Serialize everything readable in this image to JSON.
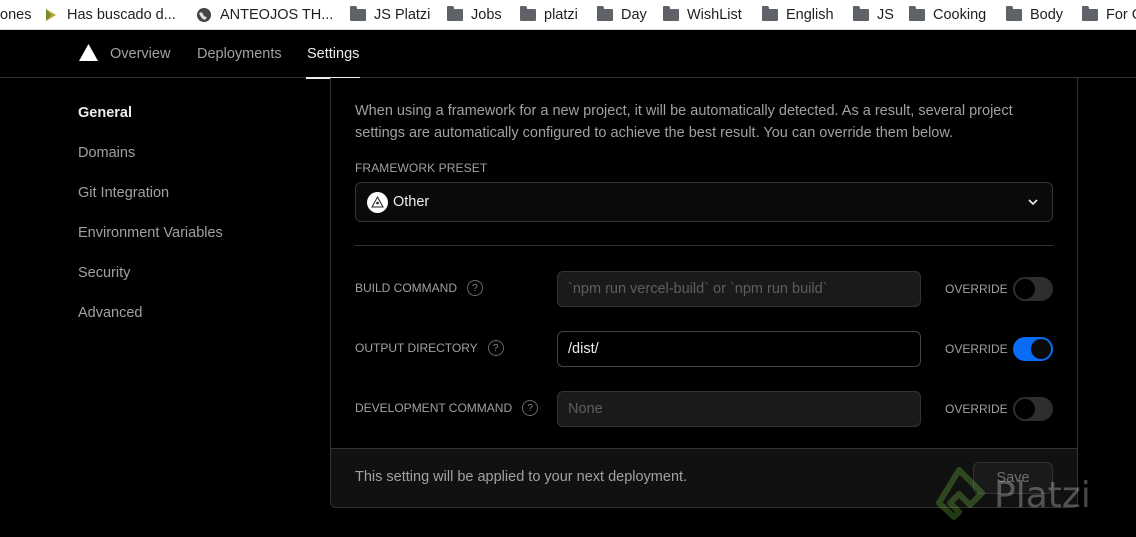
{
  "bookmarks": [
    {
      "label": "ones",
      "icon": "none"
    },
    {
      "label": "Has buscado d...",
      "icon": "arrow-icon"
    },
    {
      "label": "ANTEOJOS TH...",
      "icon": "globe-icon"
    },
    {
      "label": "JS Platzi",
      "icon": "folder-icon"
    },
    {
      "label": "Jobs",
      "icon": "folder-icon"
    },
    {
      "label": "platzi",
      "icon": "folder-icon"
    },
    {
      "label": "Day",
      "icon": "folder-icon"
    },
    {
      "label": "WishList",
      "icon": "folder-icon"
    },
    {
      "label": "English",
      "icon": "folder-icon"
    },
    {
      "label": "JS",
      "icon": "folder-icon"
    },
    {
      "label": "Cooking",
      "icon": "folder-icon"
    },
    {
      "label": "Body",
      "icon": "folder-icon"
    },
    {
      "label": "For G",
      "icon": "folder-icon"
    }
  ],
  "nav": {
    "tabs": [
      {
        "label": "Overview"
      },
      {
        "label": "Deployments"
      },
      {
        "label": "Settings",
        "active": true
      }
    ]
  },
  "sidebar": {
    "items": [
      {
        "label": "General",
        "active": true
      },
      {
        "label": "Domains"
      },
      {
        "label": "Git Integration"
      },
      {
        "label": "Environment Variables"
      },
      {
        "label": "Security"
      },
      {
        "label": "Advanced"
      }
    ]
  },
  "card": {
    "description": "When using a framework for a new project, it will be automatically detected. As a result, several project settings are automatically configured to achieve the best result. You can override them below.",
    "framework_preset": {
      "label": "FRAMEWORK PRESET",
      "value": "Other"
    },
    "rows": [
      {
        "label": "BUILD COMMAND",
        "placeholder": "`npm run vercel-build` or `npm run build`",
        "value": "",
        "override_label": "OVERRIDE",
        "override": false
      },
      {
        "label": "OUTPUT DIRECTORY",
        "placeholder": "",
        "value": "/dist/",
        "override_label": "OVERRIDE",
        "override": true
      },
      {
        "label": "DEVELOPMENT COMMAND",
        "placeholder": "None",
        "value": "",
        "override_label": "OVERRIDE",
        "override": false
      }
    ],
    "footer": {
      "note": "This setting will be applied to your next deployment.",
      "save_label": "Save"
    }
  },
  "watermark": {
    "text": "Platzi"
  },
  "colors": {
    "accent": "#0a6cf5",
    "background": "#000000",
    "border": "#333333"
  }
}
